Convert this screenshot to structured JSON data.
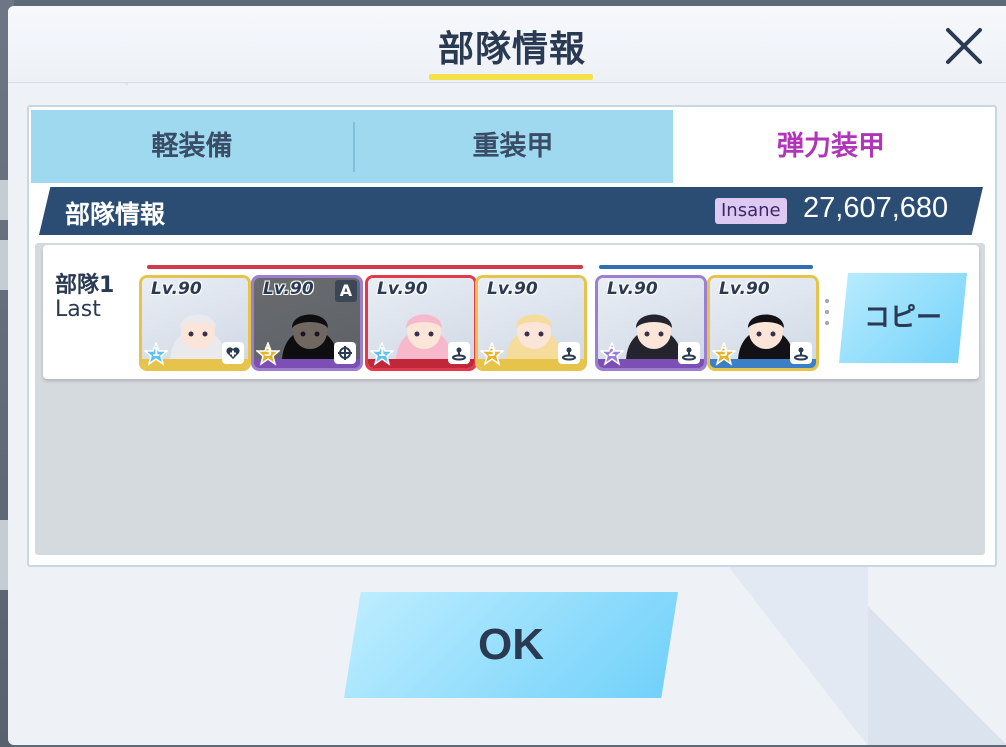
{
  "dialog": {
    "title": "部隊情報",
    "close_icon": "close-icon"
  },
  "tabs": [
    {
      "label": "軽装備",
      "active": false
    },
    {
      "label": "重装甲",
      "active": false
    },
    {
      "label": "弾力装甲",
      "active": true
    }
  ],
  "info_bar": {
    "title": "部隊情報",
    "difficulty": "Insane",
    "score": "27,607,680"
  },
  "team": {
    "name": "部隊1",
    "sub": "Last",
    "striker_line_color": "#d03a4a",
    "special_line_color": "#2f6fb7",
    "members": [
      {
        "level": "Lv.90",
        "star": "1",
        "role": "heal-icon",
        "slot": "striker",
        "frame": "#e6c34a",
        "bottom": "#e6c34a",
        "hair": "#e9e9ee"
      },
      {
        "level": "Lv.90",
        "star": "3",
        "role": "target-icon",
        "slot": "striker",
        "frame": "#9d7fd2",
        "bottom": "#7c4fb5",
        "hair": "#1e1e24",
        "assist": "A"
      },
      {
        "level": "Lv.90",
        "star": "1",
        "role": "tank-icon",
        "slot": "striker",
        "frame": "#e23a4a",
        "bottom": "#c0283a",
        "hair": "#f7b8cc"
      },
      {
        "level": "Lv.90",
        "star": "3",
        "role": "tank-icon",
        "slot": "striker",
        "frame": "#e6c34a",
        "bottom": "#e6c34a",
        "hair": "#f6dc9a"
      },
      {
        "level": "Lv.90",
        "star": "2",
        "role": "tank-icon",
        "slot": "special",
        "frame": "#9d7fd2",
        "bottom": "#7c4fb5",
        "hair": "#23242e"
      },
      {
        "level": "Lv.90",
        "star": "3",
        "role": "tank-icon",
        "slot": "special",
        "frame": "#e6c34a",
        "bottom": "#3d7fc5",
        "hair": "#121216"
      }
    ]
  },
  "buttons": {
    "copy_label": "コピー",
    "ok_label": "OK"
  },
  "colors": {
    "accent_tab": "#b135b8",
    "info_bar": "#2b4d73",
    "button_blue": "#73d2fa"
  }
}
